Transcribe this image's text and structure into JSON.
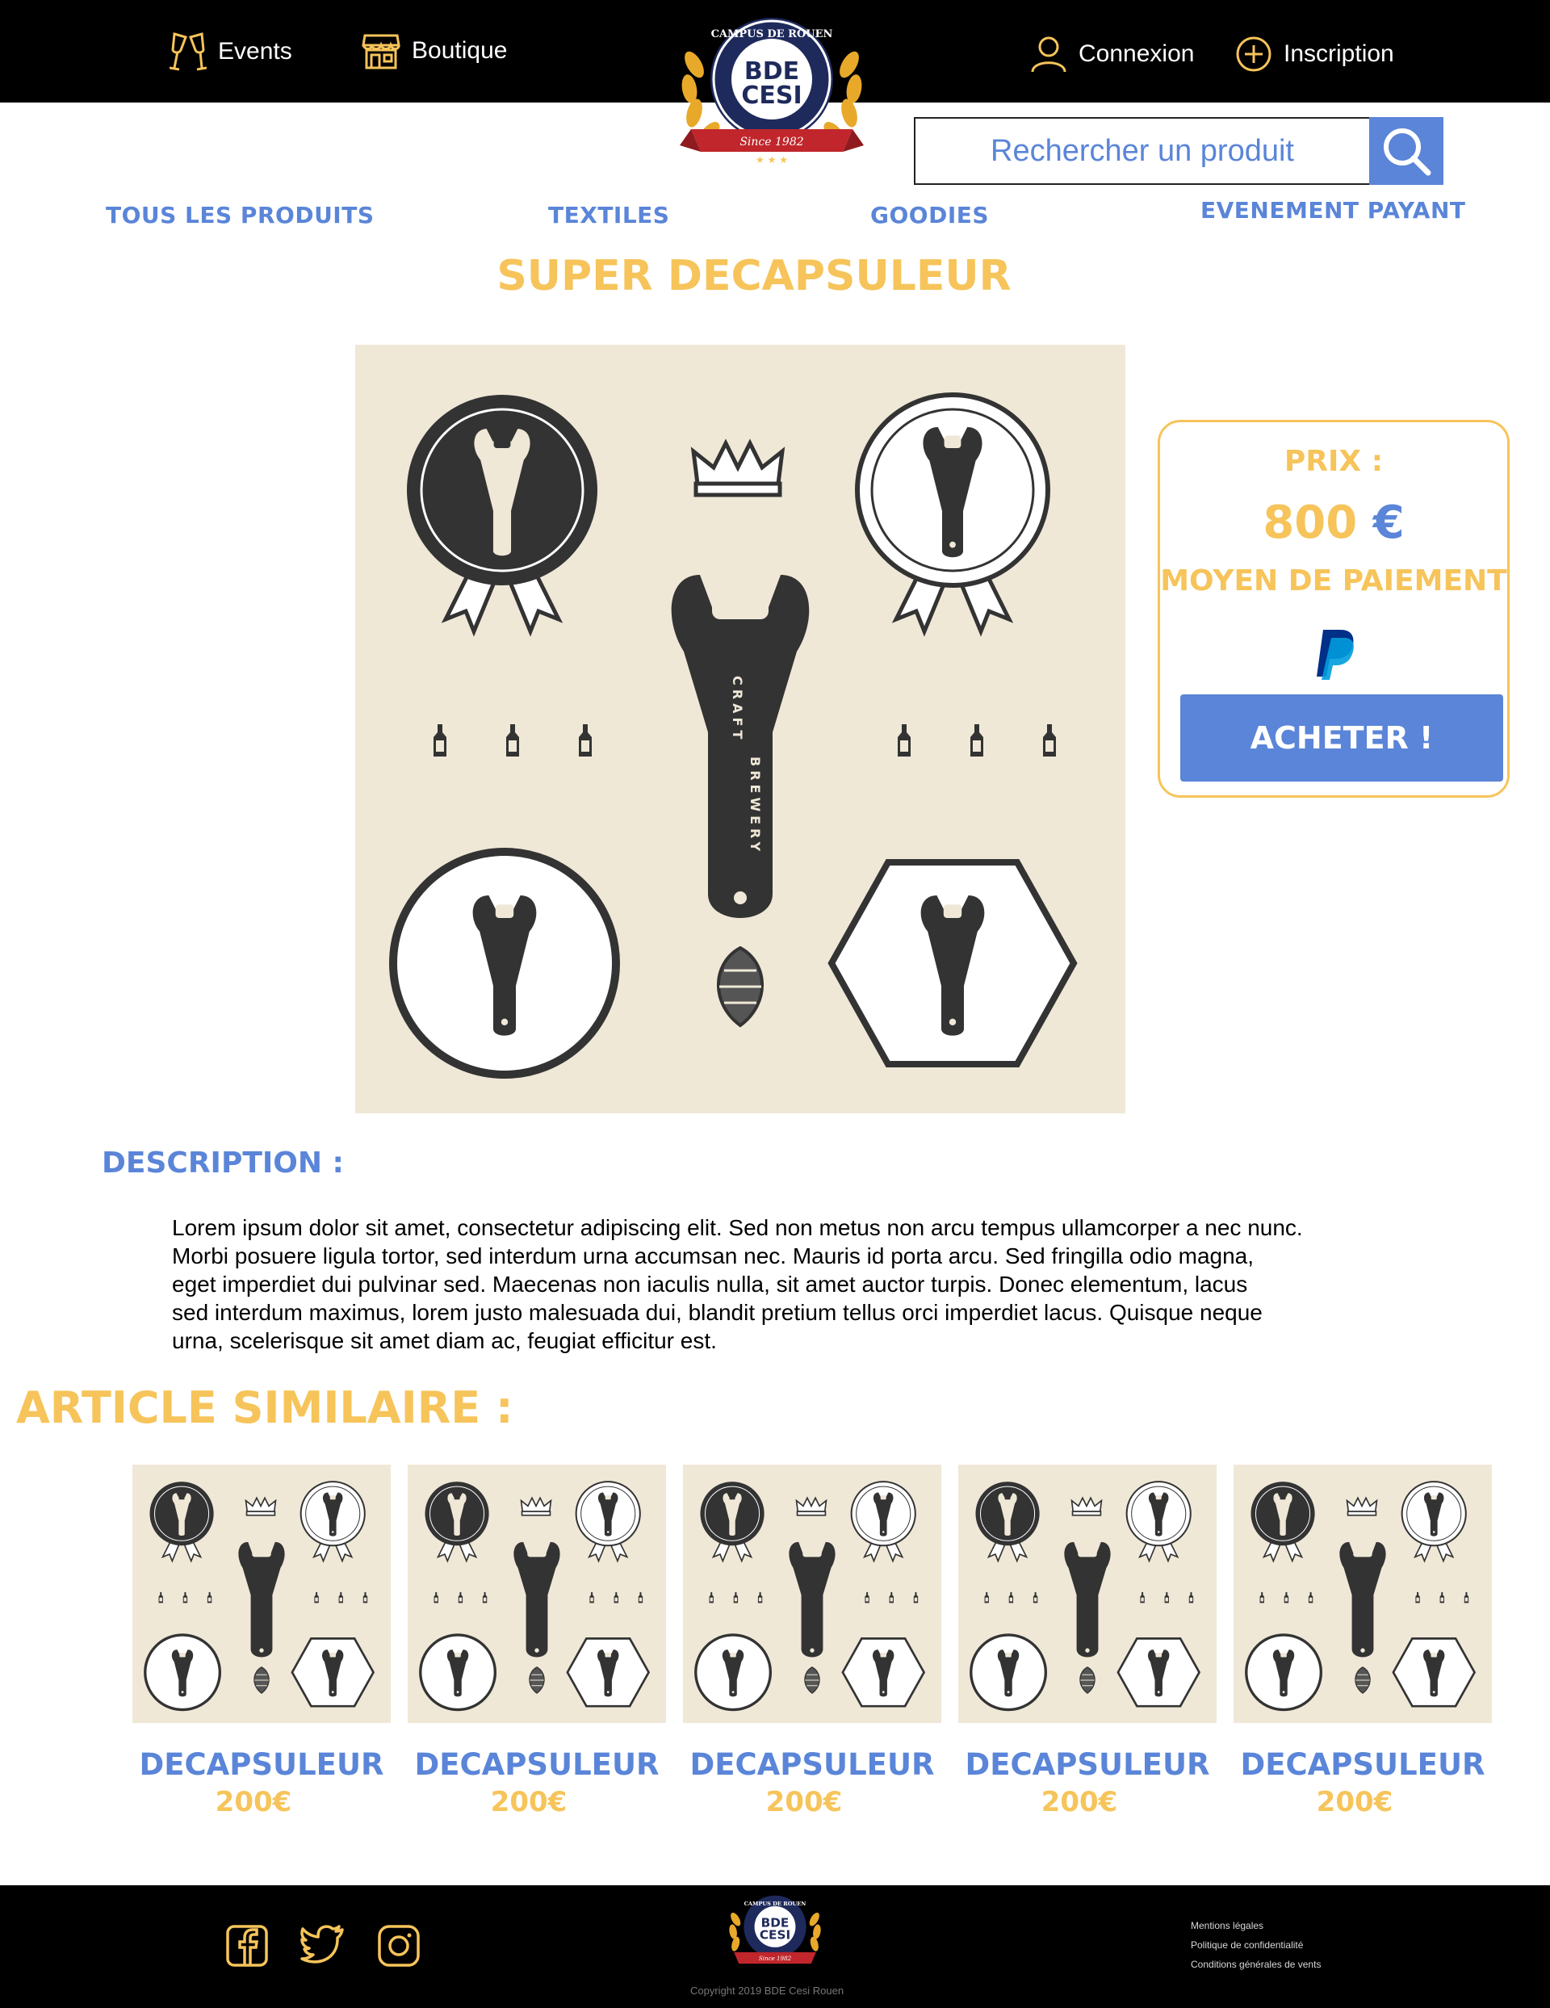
{
  "header": {
    "nav_left": [
      {
        "label": "Events",
        "icon": "champagne-glasses-icon"
      },
      {
        "label": "Boutique",
        "icon": "shop-icon"
      }
    ],
    "nav_right": [
      {
        "label": "Connexion",
        "icon": "user-icon"
      },
      {
        "label": "Inscription",
        "icon": "plus-circle-icon"
      }
    ],
    "logo": {
      "arc_text": "CAMPUS DE ROUEN",
      "line1": "BDE",
      "line2": "CESI",
      "ribbon": "Since 1982"
    }
  },
  "search": {
    "placeholder": "Rechercher un produit",
    "icon": "search-icon"
  },
  "categories": [
    "TOUS LES PRODUITS",
    "TEXTILES",
    "GOODIES",
    "EVENEMENT PAYANT"
  ],
  "product": {
    "title": "SUPER DECAPSULEUR",
    "image_text": [
      "CRAFT",
      "BREWERY"
    ],
    "price_label": "PRIX :",
    "price_value": "800",
    "currency": "€",
    "payment_label": "MOYEN DE PAIEMENT",
    "payment_icon": "paypal-icon",
    "buy_label": "ACHETER !"
  },
  "description": {
    "heading": "DESCRIPTION :",
    "lines": [
      "Lorem ipsum dolor sit amet, consectetur adipiscing elit. Sed non metus non arcu tempus ullamcorper a nec nunc.",
      "Morbi posuere ligula tortor, sed interdum urna accumsan nec. Mauris id porta arcu. Sed fringilla odio magna,",
      "eget imperdiet dui pulvinar sed. Maecenas non iaculis nulla, sit amet auctor turpis. Donec elementum, lacus",
      "sed interdum maximus, lorem justo malesuada dui, blandit pretium tellus orci imperdiet lacus. Quisque neque",
      "urna, scelerisque sit amet diam ac, feugiat efficitur est."
    ]
  },
  "similar": {
    "heading": "ARTICLE SIMILAIRE :",
    "items": [
      {
        "name": "DECAPSULEUR",
        "price": "200€"
      },
      {
        "name": "DECAPSULEUR",
        "price": "200€"
      },
      {
        "name": "DECAPSULEUR",
        "price": "200€"
      },
      {
        "name": "DECAPSULEUR",
        "price": "200€"
      },
      {
        "name": "DECAPSULEUR",
        "price": "200€"
      }
    ]
  },
  "footer": {
    "social": [
      "facebook-icon",
      "twitter-icon",
      "instagram-icon"
    ],
    "legal_links": [
      "Mentions légales",
      "Politique de confidentialité",
      "Conditions générales de vents"
    ],
    "copyright": "Copyright 2019 BDE Cesi Rouen"
  },
  "colors": {
    "accent_blue": "#5a85d8",
    "accent_yellow": "#f6c45a",
    "header_bg": "#000000",
    "image_bg": "#efe8d7"
  }
}
